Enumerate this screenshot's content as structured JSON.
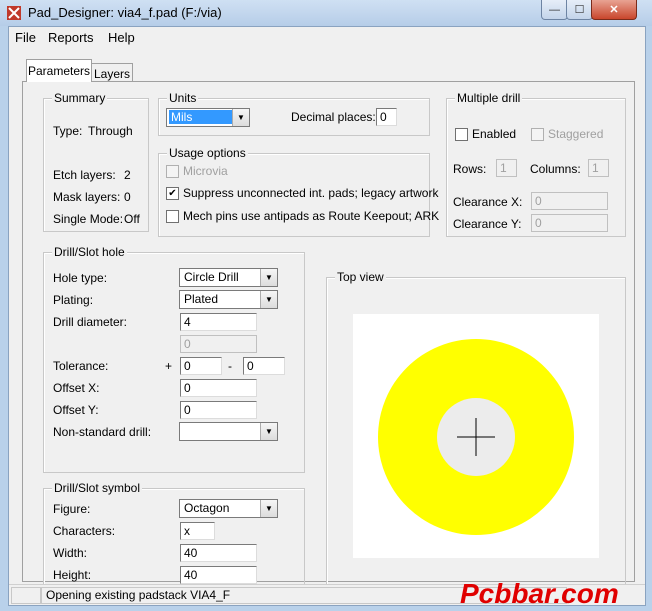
{
  "window": {
    "title": "Pad_Designer: via4_f.pad (F:/via)",
    "minimize_label": "—",
    "maximize_label": "☐",
    "close_label": "✕"
  },
  "menu": [
    "File",
    "Reports",
    "Help"
  ],
  "tabs": [
    "Parameters",
    "Layers"
  ],
  "summary": {
    "title": "Summary",
    "type_label": "Type:",
    "type_value": "Through",
    "etch_label": "Etch layers:",
    "etch_value": "2",
    "mask_label": "Mask layers:",
    "mask_value": "0",
    "single_label": "Single Mode:",
    "single_value": "Off"
  },
  "units": {
    "title": "Units",
    "unit_value": "Mils",
    "decimal_label": "Decimal places:",
    "decimal_value": "0"
  },
  "usage": {
    "title": "Usage options",
    "microvia": "Microvia",
    "suppress": "Suppress unconnected int. pads; legacy artwork",
    "mech": "Mech pins use antipads as Route Keepout; ARK",
    "suppress_checked": "✔"
  },
  "multiple_drill": {
    "title": "Multiple drill",
    "enabled": "Enabled",
    "staggered": "Staggered",
    "rows_label": "Rows:",
    "rows_value": "1",
    "columns_label": "Columns:",
    "columns_value": "1",
    "clearance_x_label": "Clearance X:",
    "clearance_x_value": "0",
    "clearance_y_label": "Clearance Y:",
    "clearance_y_value": "0"
  },
  "drill_hole": {
    "title": "Drill/Slot hole",
    "hole_type_label": "Hole type:",
    "hole_type_value": "Circle Drill",
    "plating_label": "Plating:",
    "plating_value": "Plated",
    "drill_diameter_label": "Drill diameter:",
    "drill_diameter_value": "4",
    "drill_diameter_2_value": "0",
    "tolerance_label": "Tolerance:",
    "tol_plus_sign": "+",
    "tol_plus_value": "0",
    "tol_minus_sign": "-",
    "tol_minus_value": "0",
    "offset_x_label": "Offset X:",
    "offset_x_value": "0",
    "offset_y_label": "Offset Y:",
    "offset_y_value": "0",
    "non_standard_label": "Non-standard drill:",
    "non_standard_value": ""
  },
  "drill_symbol": {
    "title": "Drill/Slot symbol",
    "figure_label": "Figure:",
    "figure_value": "Octagon",
    "characters_label": "Characters:",
    "characters_value": "x",
    "width_label": "Width:",
    "width_value": "40",
    "height_label": "Height:",
    "height_value": "40"
  },
  "top_view": {
    "title": "Top view",
    "pad_color": "#ffff00",
    "hole_color": "#ececec",
    "background_color": "#ffffff"
  },
  "status": {
    "message": "Opening existing padstack VIA4_F"
  },
  "watermark": "Pcbbar.com"
}
